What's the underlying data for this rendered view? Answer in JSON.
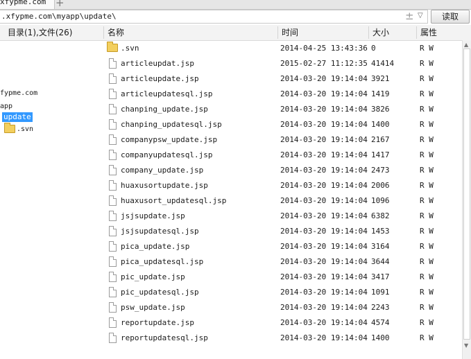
{
  "tab": {
    "title": "xfypme.com"
  },
  "address": {
    "path": ".xfypme.com\\myapp\\update\\",
    "read_label": "读取"
  },
  "icons": {
    "upload": "upload-icon",
    "dropdown": "dropdown-icon",
    "folder": "folder-icon",
    "file": "file-icon",
    "add_tab": "plus-icon"
  },
  "header": {
    "summary": "目录(1),文件(26)",
    "name": "名称",
    "time": "时间",
    "size": "大小",
    "attr": "属性"
  },
  "tree": {
    "site": "fypme.com",
    "app": "app",
    "current": "update",
    "child": ".svn"
  },
  "files": [
    {
      "type": "folder",
      "name": ".svn",
      "time": "2014-04-25 13:43:36",
      "size": "0",
      "attr": "R W"
    },
    {
      "type": "file",
      "name": "articleupdat.jsp",
      "time": "2015-02-27 11:12:35",
      "size": "41414",
      "attr": "R W"
    },
    {
      "type": "file",
      "name": "articleupdate.jsp",
      "time": "2014-03-20 19:14:04",
      "size": "3921",
      "attr": "R W"
    },
    {
      "type": "file",
      "name": "articleupdatesql.jsp",
      "time": "2014-03-20 19:14:04",
      "size": "1419",
      "attr": "R W"
    },
    {
      "type": "file",
      "name": "chanping_update.jsp",
      "time": "2014-03-20 19:14:04",
      "size": "3826",
      "attr": "R W"
    },
    {
      "type": "file",
      "name": "chanping_updatesql.jsp",
      "time": "2014-03-20 19:14:04",
      "size": "1400",
      "attr": "R W"
    },
    {
      "type": "file",
      "name": "companypsw_update.jsp",
      "time": "2014-03-20 19:14:04",
      "size": "2167",
      "attr": "R W"
    },
    {
      "type": "file",
      "name": "companyupdatesql.jsp",
      "time": "2014-03-20 19:14:04",
      "size": "1417",
      "attr": "R W"
    },
    {
      "type": "file",
      "name": "company_update.jsp",
      "time": "2014-03-20 19:14:04",
      "size": "2473",
      "attr": "R W"
    },
    {
      "type": "file",
      "name": "huaxusortupdate.jsp",
      "time": "2014-03-20 19:14:04",
      "size": "2006",
      "attr": "R W"
    },
    {
      "type": "file",
      "name": "huaxusort_updatesql.jsp",
      "time": "2014-03-20 19:14:04",
      "size": "1096",
      "attr": "R W"
    },
    {
      "type": "file",
      "name": "jsjsupdate.jsp",
      "time": "2014-03-20 19:14:04",
      "size": "6382",
      "attr": "R W"
    },
    {
      "type": "file",
      "name": "jsjsupdatesql.jsp",
      "time": "2014-03-20 19:14:04",
      "size": "1453",
      "attr": "R W"
    },
    {
      "type": "file",
      "name": "pica_update.jsp",
      "time": "2014-03-20 19:14:04",
      "size": "3164",
      "attr": "R W"
    },
    {
      "type": "file",
      "name": "pica_updatesql.jsp",
      "time": "2014-03-20 19:14:04",
      "size": "3644",
      "attr": "R W"
    },
    {
      "type": "file",
      "name": "pic_update.jsp",
      "time": "2014-03-20 19:14:04",
      "size": "3417",
      "attr": "R W"
    },
    {
      "type": "file",
      "name": "pic_updatesql.jsp",
      "time": "2014-03-20 19:14:04",
      "size": "1091",
      "attr": "R W"
    },
    {
      "type": "file",
      "name": "psw_update.jsp",
      "time": "2014-03-20 19:14:04",
      "size": "2243",
      "attr": "R W"
    },
    {
      "type": "file",
      "name": "reportupdate.jsp",
      "time": "2014-03-20 19:14:04",
      "size": "4574",
      "attr": "R W"
    },
    {
      "type": "file",
      "name": "reportupdatesql.jsp",
      "time": "2014-03-20 19:14:04",
      "size": "1400",
      "attr": "R W"
    }
  ]
}
